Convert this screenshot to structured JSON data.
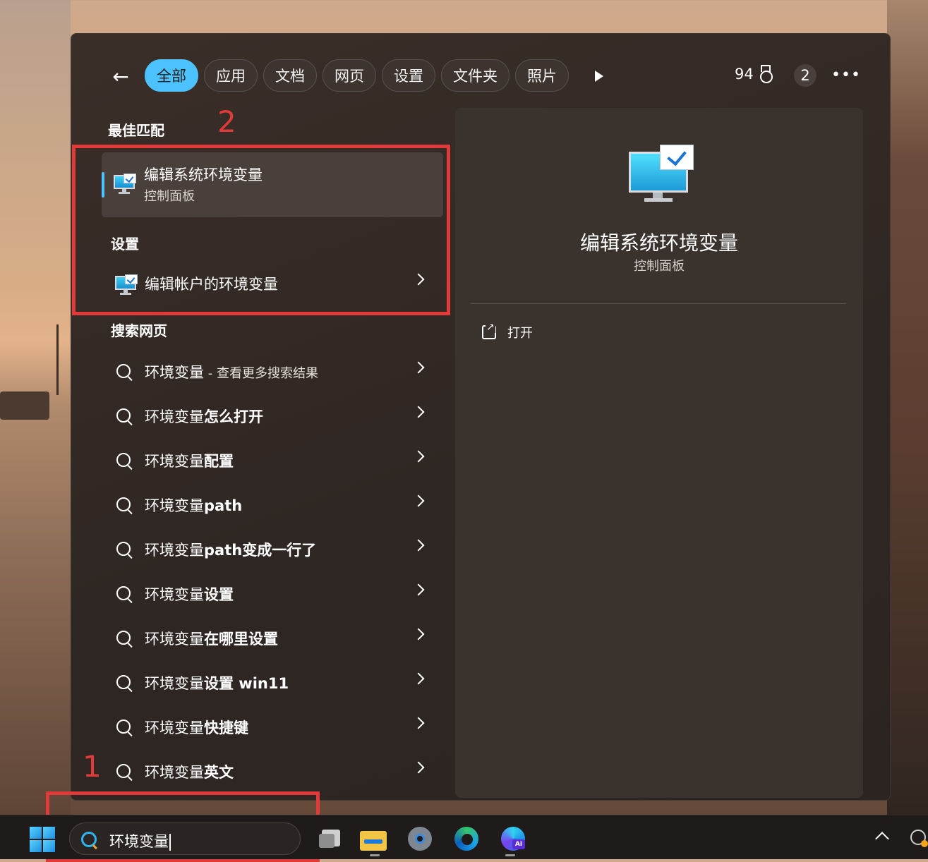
{
  "tabs": [
    "全部",
    "应用",
    "文档",
    "网页",
    "设置",
    "文件夹",
    "照片"
  ],
  "header": {
    "points": "94",
    "badge_count": "2"
  },
  "best_match": {
    "section_title": "最佳匹配",
    "item": {
      "title": "编辑系统环境变量",
      "subtitle": "控制面板"
    }
  },
  "settings": {
    "section_title": "设置",
    "item": {
      "title": "编辑帐户的环境变量"
    }
  },
  "web": {
    "section_title": "搜索网页",
    "results": [
      {
        "prefix": "环境变量",
        "suffix": "",
        "extra": " - 查看更多搜索结果"
      },
      {
        "prefix": "环境变量",
        "suffix": "怎么打开",
        "extra": ""
      },
      {
        "prefix": "环境变量",
        "suffix": "配置",
        "extra": ""
      },
      {
        "prefix": "环境变量",
        "suffix": "path",
        "extra": ""
      },
      {
        "prefix": "环境变量",
        "suffix": "path变成一行了",
        "extra": ""
      },
      {
        "prefix": "环境变量",
        "suffix": "设置",
        "extra": ""
      },
      {
        "prefix": "环境变量",
        "suffix": "在哪里设置",
        "extra": ""
      },
      {
        "prefix": "环境变量",
        "suffix": "设置 win11",
        "extra": ""
      },
      {
        "prefix": "环境变量",
        "suffix": "快捷键",
        "extra": ""
      },
      {
        "prefix": "环境变量",
        "suffix": "英文",
        "extra": ""
      }
    ]
  },
  "detail": {
    "title": "编辑系统环境变量",
    "subtitle": "控制面板",
    "open_label": "打开"
  },
  "annotations": {
    "num1": "1",
    "num2": "2"
  },
  "taskbar": {
    "search_value": "环境变量",
    "edge_ai_badge": "AI"
  },
  "colors": {
    "accent": "#4cc2ff",
    "annotation": "#e03a3a"
  }
}
